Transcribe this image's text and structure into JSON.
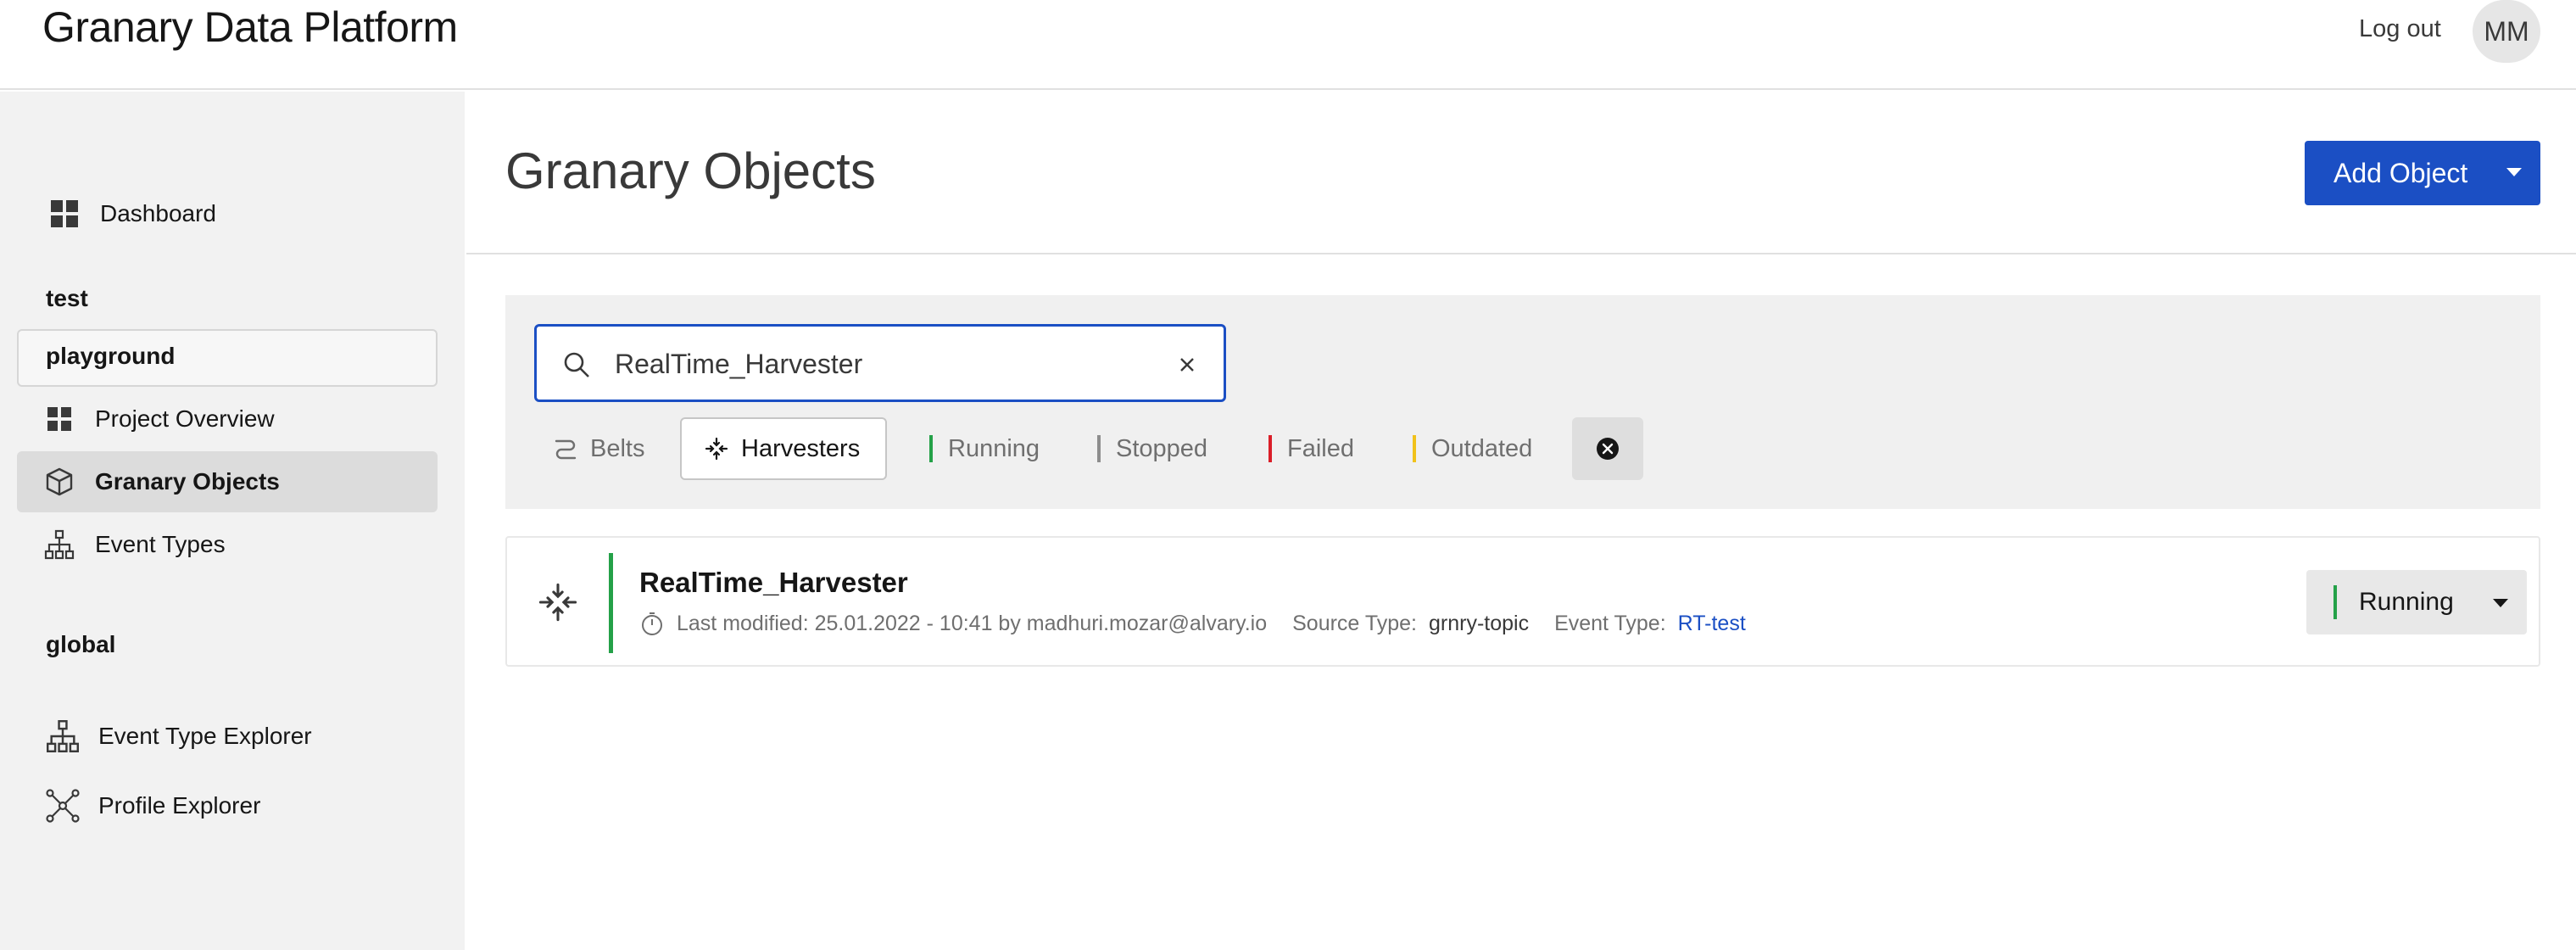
{
  "header": {
    "app_title": "Granary Data Platform",
    "logout_label": "Log out",
    "avatar_initials": "MM"
  },
  "sidebar": {
    "dashboard": "Dashboard",
    "section_test": "test",
    "project_name": "playground",
    "items": [
      {
        "label": "Project Overview",
        "icon": "grid-icon"
      },
      {
        "label": "Granary Objects",
        "icon": "cube-icon",
        "active": true
      },
      {
        "label": "Event Types",
        "icon": "hierarchy-icon"
      }
    ],
    "section_global": "global",
    "global_items": [
      {
        "label": "Event Type Explorer",
        "icon": "hierarchy-icon"
      },
      {
        "label": "Profile Explorer",
        "icon": "network-icon"
      }
    ]
  },
  "main": {
    "page_title": "Granary Objects",
    "add_button": "Add Object",
    "search": {
      "value": "RealTime_Harvester"
    },
    "filters": {
      "belts": "Belts",
      "harvesters": "Harvesters",
      "running": "Running",
      "stopped": "Stopped",
      "failed": "Failed",
      "outdated": "Outdated"
    },
    "result": {
      "name": "RealTime_Harvester",
      "last_modified": "Last modified: 25.01.2022 - 10:41 by madhuri.mozar@alvary.io",
      "source_type_label": "Source Type:",
      "source_type_value": "grnry-topic",
      "event_type_label": "Event Type:",
      "event_type_value": "RT-test",
      "status": "Running"
    }
  },
  "colors": {
    "accent": "#1b4fc4",
    "running": "#24a148",
    "stopped": "#8d8d8d",
    "failed": "#da1e28",
    "outdated": "#f1c21b"
  }
}
